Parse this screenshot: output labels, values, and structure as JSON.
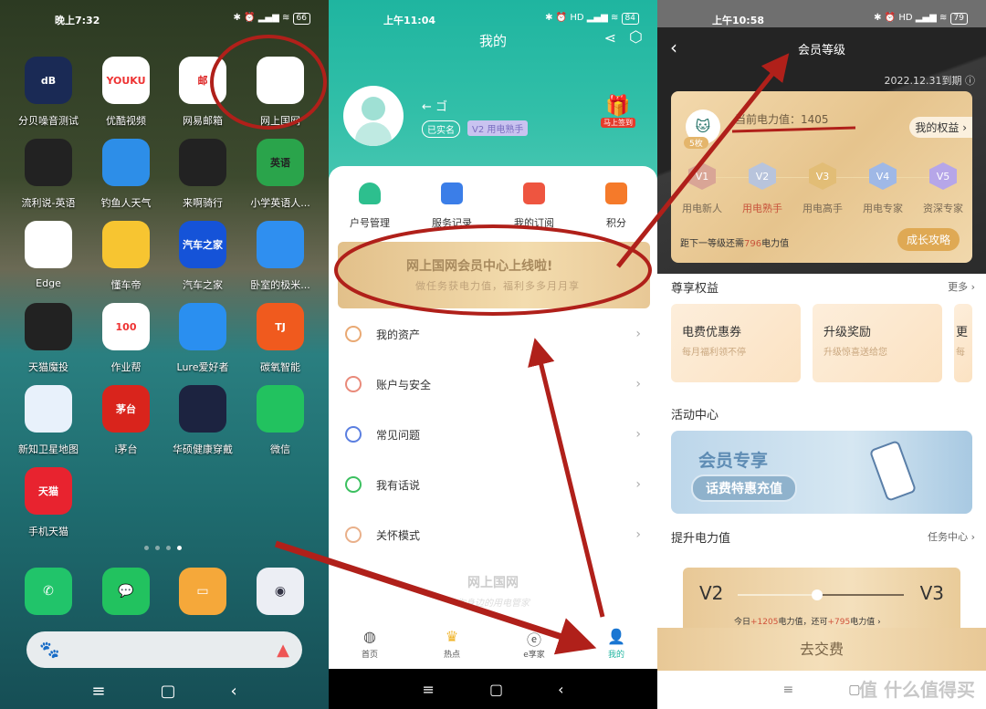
{
  "home": {
    "time": "晚上7:32",
    "battery": "66",
    "apps": [
      "分贝噪音测试",
      "优酷视频",
      "网易邮箱",
      "网上国网",
      "流利说-英语",
      "钓鱼人天气",
      "来啊骑行",
      "小学英语人...",
      "Edge",
      "懂车帝",
      "汽车之家",
      "卧室的极米...",
      "天猫魔投",
      "作业帮",
      "Lure爱好者",
      "碳氧智能",
      "新知卫星地图",
      "i茅台",
      "华硕健康穿戴",
      "微信",
      "手机天猫"
    ],
    "icon_texts": {
      "db": "dB",
      "youku": "YOUKU",
      "mail": "邮",
      "english": "英语",
      "autohome": "汽车之家",
      "zyb": "100",
      "tanyang": "TJ",
      "moutai": "茅台",
      "tmall": "天猫"
    },
    "dock": [
      "phone-icon",
      "wechat-icon",
      "notes-icon",
      "camera-icon"
    ]
  },
  "mine": {
    "time": "上午11:04",
    "battery": "84",
    "title": "我的",
    "username": "←  ゴ",
    "verified": "已实名",
    "level_badge": "用电熟手",
    "level_code": "V2",
    "checkin": "马上签到",
    "quick": [
      "户号管理",
      "服务记录",
      "我的订阅",
      "积分"
    ],
    "banner": {
      "title": "网上国网会员中心上线啦!",
      "subtitle": "做任务获电力值，福利多多月月享"
    },
    "menu": [
      "我的资产",
      "账户与安全",
      "常见问题",
      "我有话说",
      "关怀模式"
    ],
    "watermark": "网上国网",
    "watermark_sub": "你身边的用电管家",
    "tabs": [
      "首页",
      "热点",
      "e享家",
      "我的"
    ],
    "active_tab": "我的",
    "accent": "#1fb5a0"
  },
  "member": {
    "time": "上午10:58",
    "battery": "79",
    "title": "会员等级",
    "expiry": "2022.12.31到期",
    "power_label": "当前电力值：",
    "power": "1405",
    "medals": "5枚",
    "my_rights": "我的权益",
    "levels": [
      {
        "code": "V1",
        "name": "用电新人"
      },
      {
        "code": "V2",
        "name": "用电熟手"
      },
      {
        "code": "V3",
        "name": "用电高手"
      },
      {
        "code": "V4",
        "name": "用电专家"
      },
      {
        "code": "V5",
        "name": "资深专家"
      }
    ],
    "current_level": "V2",
    "next_pre": "距下一等级还需",
    "next_value": "796",
    "next_post": "电力值",
    "guide": "成长攻略",
    "rights_title": "尊享权益",
    "more": "更多",
    "benefits": [
      {
        "title": "电费优惠券",
        "sub": "每月福利领不停"
      },
      {
        "title": "升级奖励",
        "sub": "升级惊喜送给您"
      },
      {
        "title": "更",
        "sub": "每"
      }
    ],
    "activity_title": "活动中心",
    "activity_banner": {
      "title": "会员专享",
      "button": "话费特惠充值"
    },
    "boost_title": "提升电力值",
    "task_center": "任务中心",
    "progress": {
      "from": "V2",
      "to": "V3",
      "today_pre": "今日",
      "today": "+1205",
      "today_post": "电力值，还可",
      "remain": "+795",
      "remain_post": "电力值"
    },
    "pay": "去交费",
    "watermark": "值 什么值得买"
  }
}
